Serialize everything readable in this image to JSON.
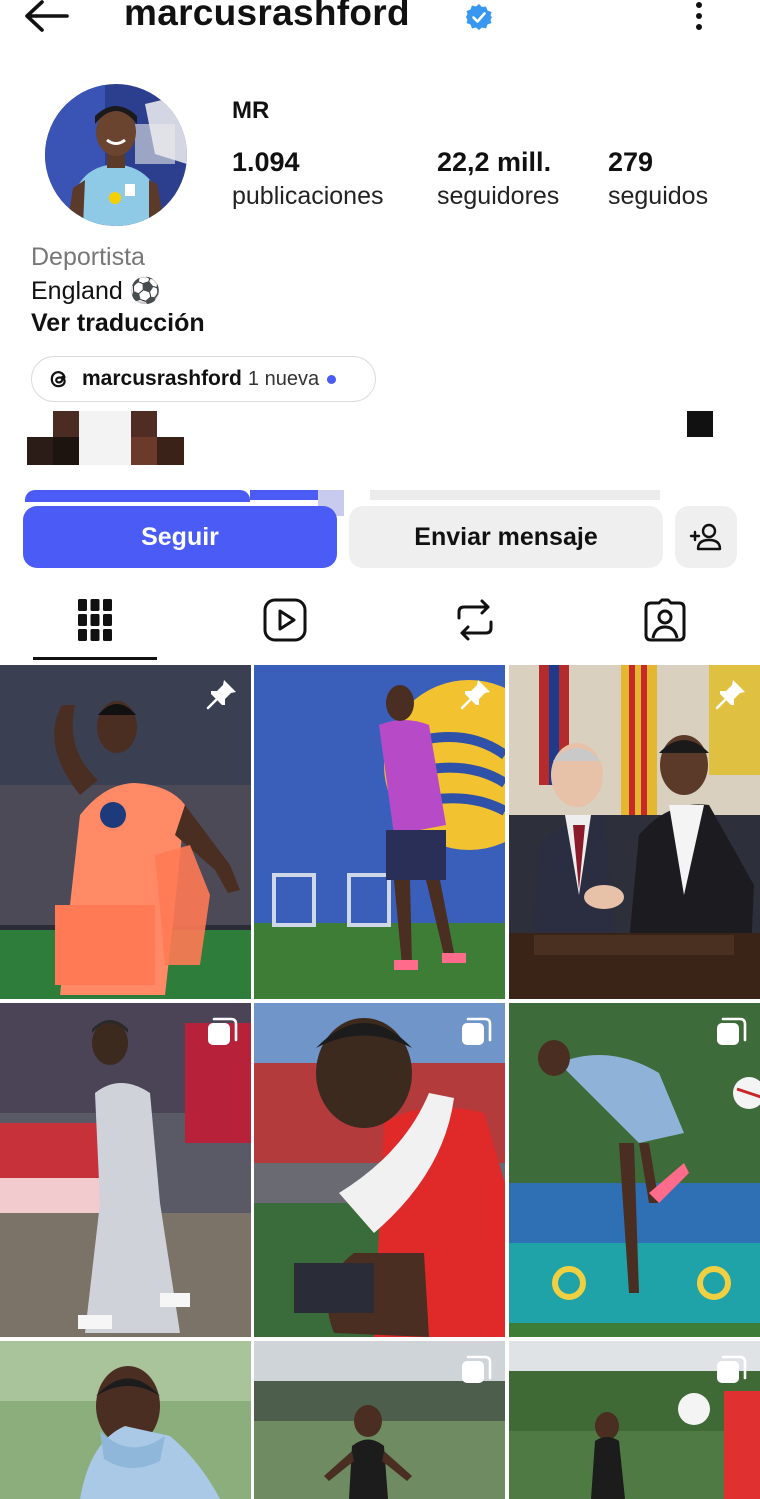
{
  "header": {
    "username": "marcusrashford",
    "back_icon": "arrow-left-icon",
    "verified_icon": "verified-badge-icon",
    "more_icon": "vertical-dots-icon"
  },
  "profile": {
    "full_name": "MR",
    "stats": [
      {
        "value": "1.094",
        "label": "publicaciones"
      },
      {
        "value": "22,2 mill.",
        "label": "seguidores"
      },
      {
        "value": "279",
        "label": "seguidos"
      }
    ],
    "category": "Deportista",
    "bio": "England ⚽",
    "translate_link": "Ver traducción",
    "threads": {
      "username": "marcusrashford",
      "badge": "1 nueva",
      "icon": "threads-icon"
    }
  },
  "actions": {
    "follow": "Seguir",
    "message": "Enviar mensaje",
    "add_icon": "add-person-icon"
  },
  "tabs": [
    {
      "id": "posts",
      "icon": "grid-icon",
      "active": true
    },
    {
      "id": "reels",
      "icon": "reels-icon",
      "active": false
    },
    {
      "id": "reposts",
      "icon": "repost-icon",
      "active": false
    },
    {
      "id": "tagged",
      "icon": "tagged-person-icon",
      "active": false
    }
  ],
  "colors": {
    "accent": "#4a5cf5",
    "verified": "#3897f0"
  },
  "grid": [
    {
      "badge": "pin-icon",
      "subject": "player-celebrating-orange-kit"
    },
    {
      "badge": "pin-icon",
      "subject": "player-training-purple-vest"
    },
    {
      "badge": "pin-icon",
      "subject": "contract-signing-handshake"
    },
    {
      "badge": "carousel-icon",
      "subject": "player-walking-grey-tracksuit"
    },
    {
      "badge": "carousel-icon",
      "subject": "player-with-towel-red-shirt"
    },
    {
      "badge": "carousel-icon",
      "subject": "player-kicking-ball-training"
    },
    {
      "badge": "none",
      "subject": "player-wiping-face"
    },
    {
      "badge": "carousel-icon",
      "subject": "player-training-black-vest"
    },
    {
      "badge": "carousel-icon",
      "subject": "player-on-training-pitch"
    }
  ]
}
